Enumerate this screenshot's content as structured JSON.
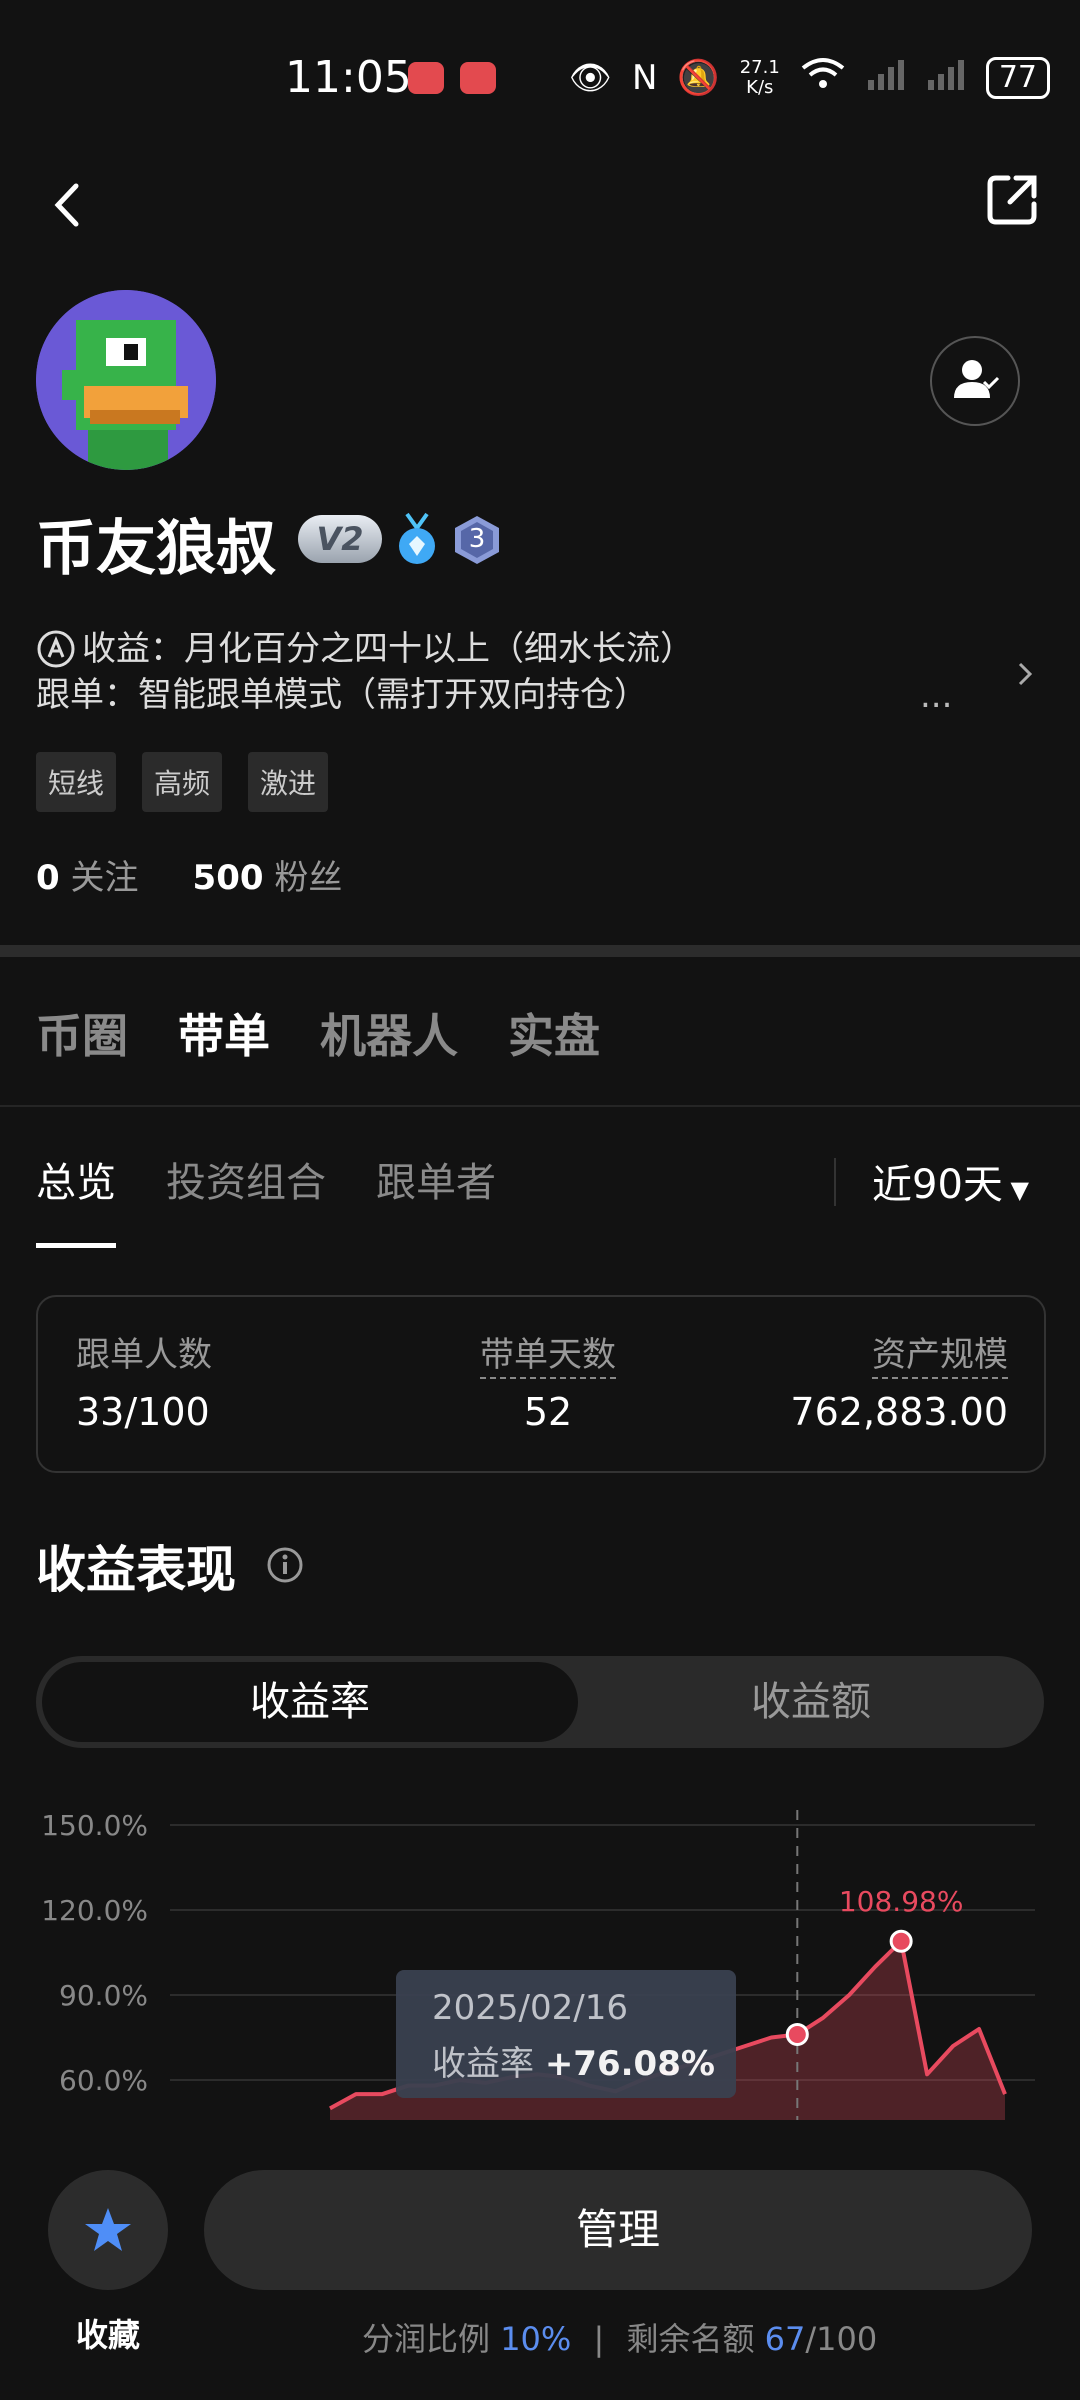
{
  "status_bar": {
    "time": "11:05",
    "net_speed_value": "27.1",
    "net_speed_unit": "K/s",
    "battery": "77"
  },
  "profile": {
    "name": "币友狼叔",
    "vip_badge": "V2",
    "level_badge": "3",
    "bio_line1": "收益：月化百分之四十以上（细水长流）",
    "bio_line2": "跟单：智能跟单模式（需打开双向持仓）",
    "bio_more": "...",
    "tags": [
      "短线",
      "高频",
      "激进"
    ],
    "following_count": "0",
    "following_label": "关注",
    "followers_count": "500",
    "followers_label": "粉丝"
  },
  "main_tabs": [
    "币圈",
    "带单",
    "机器人",
    "实盘"
  ],
  "main_tab_active": "带单",
  "sub_tabs": [
    "总览",
    "投资组合",
    "跟单者"
  ],
  "range_label": "近90天",
  "stats": {
    "followers_label": "跟单人数",
    "followers_value": "33/100",
    "days_label": "带单天数",
    "days_value": "52",
    "aum_label": "资产规模",
    "aum_value": "762,883.00"
  },
  "performance": {
    "title": "收益表现",
    "toggle_active": "收益率",
    "toggle_inactive": "收益额"
  },
  "chart_data": {
    "type": "area",
    "y_ticks": [
      "150.0%",
      "120.0%",
      "90.0%",
      "60.0%"
    ],
    "ylim": [
      60,
      150
    ],
    "peak_label": "108.98%",
    "peak_value": 108.98,
    "tooltip_date": "2025/02/16",
    "tooltip_label": "收益率",
    "tooltip_value": "+76.08%",
    "selected_value": 76.08,
    "colors": {
      "line": "#e84a5f",
      "grid": "#2c2c2c"
    },
    "x": [
      1,
      2,
      3,
      4,
      5,
      6,
      7,
      8,
      9,
      10,
      11,
      12,
      13,
      14,
      15,
      16,
      17,
      18,
      19,
      20,
      21,
      22,
      23,
      24,
      25,
      26,
      27
    ],
    "values": [
      50,
      55,
      55,
      58,
      58,
      60,
      59,
      61,
      62,
      61,
      58,
      56,
      60,
      63,
      66,
      69,
      72,
      75,
      76.08,
      82,
      90,
      100,
      108.98,
      62,
      72,
      78,
      55
    ]
  },
  "bottom_bar": {
    "favorite_label": "收藏",
    "manage_label": "管理",
    "profit_share_label": "分润比例",
    "profit_share_value": "10%",
    "separator": "|",
    "remaining_label": "剩余名额",
    "remaining_value": "67",
    "remaining_total": "/100"
  }
}
